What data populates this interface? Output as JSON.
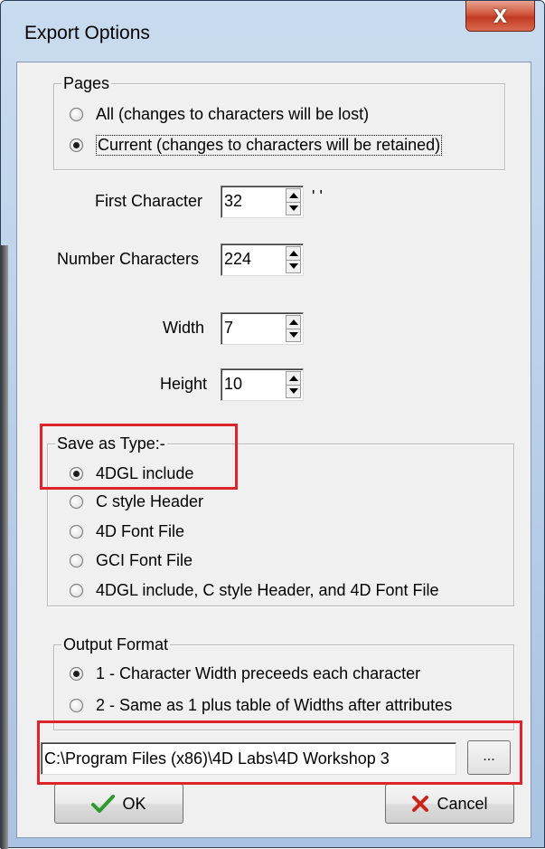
{
  "window": {
    "title": "Export Options",
    "close_glyph": "X"
  },
  "pages_group": {
    "legend": "Pages",
    "options": [
      {
        "label": "All (changes to characters will be lost)",
        "checked": false
      },
      {
        "label": "Current (changes to characters will be retained)",
        "checked": true
      }
    ]
  },
  "fields": {
    "first_character": {
      "label": "First Character",
      "value": "32"
    },
    "first_character_preview": "' '",
    "number_characters": {
      "label": "Number Characters",
      "value": "224"
    },
    "width": {
      "label": "Width",
      "value": "7"
    },
    "height": {
      "label": "Height",
      "value": "10"
    }
  },
  "save_type_group": {
    "legend": "Save as Type:-",
    "options": [
      {
        "label": "4DGL include",
        "checked": true
      },
      {
        "label": "C style Header",
        "checked": false
      },
      {
        "label": "4D Font File",
        "checked": false
      },
      {
        "label": "GCI Font File",
        "checked": false
      },
      {
        "label": "4DGL include, C style Header, and 4D Font File",
        "checked": false
      }
    ]
  },
  "output_format_group": {
    "legend": "Output Format",
    "options": [
      {
        "label": "1 - Character Width preceeds each character",
        "checked": true
      },
      {
        "label": "2 - Same as 1 plus table of Widths after attributes",
        "checked": false
      }
    ]
  },
  "output_path": {
    "value": "C:\\Program Files (x86)\\4D Labs\\4D Workshop 3",
    "browse_label": "..."
  },
  "buttons": {
    "ok_label": "OK",
    "cancel_label": "Cancel"
  },
  "colors": {
    "highlight": "#e0222a",
    "ok_check": "#2e9a2e",
    "cancel_x": "#c8261d"
  }
}
